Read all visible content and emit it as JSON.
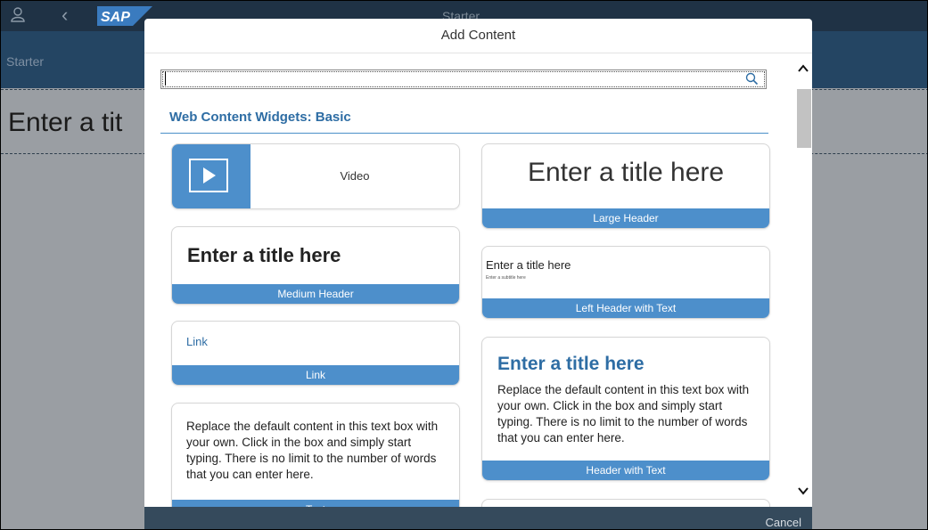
{
  "shell": {
    "logo_text": "SAP",
    "title": "Starter",
    "subnav_label": "Starter",
    "page_title": "Enter a tit"
  },
  "dialog": {
    "title": "Add Content",
    "search": {
      "value": "",
      "placeholder": ""
    },
    "section_title": "Web Content Widgets: Basic",
    "cancel_label": "Cancel"
  },
  "widgets": {
    "video": {
      "label": "Video"
    },
    "medium_header": {
      "title": "Enter a title here",
      "footer": "Medium Header"
    },
    "link": {
      "text": "Link",
      "footer": "Link"
    },
    "text": {
      "body": "Replace the default content in this text box with your own. Click in the box and simply start typing. There is no limit to the number of words that you can enter here.",
      "footer": "Text"
    },
    "large_header": {
      "title": "Enter a title here",
      "footer": "Large Header"
    },
    "left_header_text": {
      "title": "Enter a title here",
      "subtitle": "Enter a subtitle here",
      "footer": "Left Header with Text"
    },
    "header_with_text": {
      "title": "Enter a title here",
      "body": "Replace the default content in this text box with your own. Click in the box and simply start typing. There is no limit to the number of words that you can enter here.",
      "footer": "Header with Text"
    }
  },
  "colors": {
    "accent": "#4d8fcb",
    "link": "#2e6da4",
    "shell": "#1f3245",
    "footer": "#354a5c"
  },
  "icons": [
    "user-icon",
    "back-icon",
    "search-icon",
    "play-icon",
    "scroll-up-icon",
    "scroll-down-icon"
  ]
}
